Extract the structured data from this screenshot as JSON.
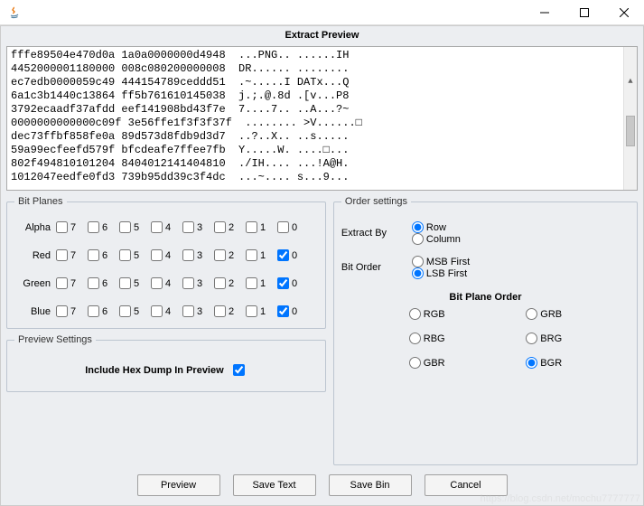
{
  "heading": "Extract Preview",
  "hexdump": "fffe89504e470d0a 1a0a0000000d4948  ...PNG.. ......IH\n4452000001180000 008c080200000008  DR...... ........\nec7edb0000059c49 444154789ceddd51  .~.....I DATx...Q\n6a1c3b1440c13864 ff5b761610145038  j.;.@.8d .[v...P8\n3792ecaadf37afdd eef141908bd43f7e  7....7.. ..A...?~\n0000000000000c09f 3e56ffe1f3f3f37f  ........ >V......□\ndec73ffbf858fe0a 89d573d8fdb9d3d7  ..?..X.. ..s.....\n59a99ecfeefd579f bfcdeafe7ffee7fb  Y.....W. ....□...\n802f494810101204 8404012141404810  ./IH.... ...!A@H.\n1012047eedfe0fd3 739b95dd39c3f4dc  ...~.... s...9...",
  "bit_planes": {
    "legend": "Bit Planes",
    "rows": [
      "Alpha",
      "Red",
      "Green",
      "Blue"
    ],
    "bits": [
      "7",
      "6",
      "5",
      "4",
      "3",
      "2",
      "1",
      "0"
    ],
    "checked": {
      "Alpha": [],
      "Red": [
        "0"
      ],
      "Green": [
        "0"
      ],
      "Blue": [
        "0"
      ]
    }
  },
  "preview_settings": {
    "legend": "Preview Settings",
    "label": "Include Hex Dump In Preview",
    "checked": true
  },
  "order_settings": {
    "legend": "Order settings",
    "extract_by_label": "Extract By",
    "extract_by": {
      "options": [
        "Row",
        "Column"
      ],
      "selected": "Row"
    },
    "bit_order_label": "Bit Order",
    "bit_order": {
      "options": [
        "MSB First",
        "LSB First"
      ],
      "selected": "LSB First"
    },
    "bit_plane_order_label": "Bit Plane Order",
    "bit_plane_order": {
      "options": [
        "RGB",
        "GRB",
        "RBG",
        "BRG",
        "GBR",
        "BGR"
      ],
      "selected": "BGR"
    }
  },
  "buttons": {
    "preview": "Preview",
    "save_text": "Save Text",
    "save_bin": "Save Bin",
    "cancel": "Cancel"
  },
  "watermark": "https://blog.csdn.net/mochu7777777"
}
